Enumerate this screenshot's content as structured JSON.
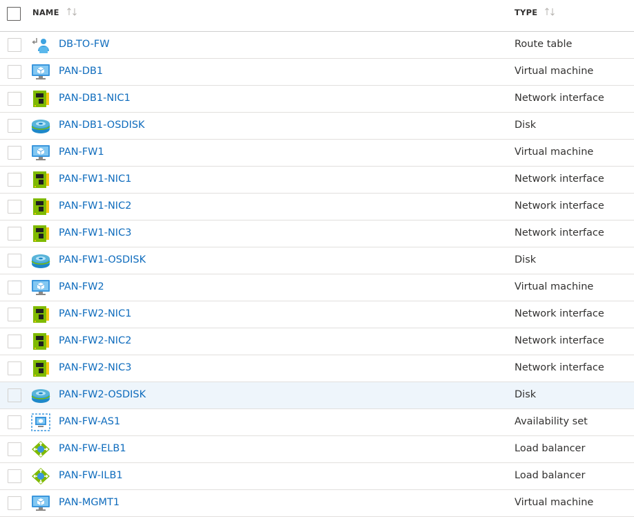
{
  "header": {
    "name_label": "NAME",
    "type_label": "TYPE"
  },
  "colors": {
    "link": "#0f6cbd",
    "selected_row": "#eef5fb",
    "border": "#e1dfdd"
  },
  "rows": [
    {
      "name": "DB-TO-FW",
      "type": "Route table",
      "icon": "route-table-icon"
    },
    {
      "name": "PAN-DB1",
      "type": "Virtual machine",
      "icon": "virtual-machine-icon"
    },
    {
      "name": "PAN-DB1-NIC1",
      "type": "Network interface",
      "icon": "network-interface-icon"
    },
    {
      "name": "PAN-DB1-OSDISK",
      "type": "Disk",
      "icon": "disk-icon"
    },
    {
      "name": "PAN-FW1",
      "type": "Virtual machine",
      "icon": "virtual-machine-icon"
    },
    {
      "name": "PAN-FW1-NIC1",
      "type": "Network interface",
      "icon": "network-interface-icon"
    },
    {
      "name": "PAN-FW1-NIC2",
      "type": "Network interface",
      "icon": "network-interface-icon"
    },
    {
      "name": "PAN-FW1-NIC3",
      "type": "Network interface",
      "icon": "network-interface-icon"
    },
    {
      "name": "PAN-FW1-OSDISK",
      "type": "Disk",
      "icon": "disk-icon"
    },
    {
      "name": "PAN-FW2",
      "type": "Virtual machine",
      "icon": "virtual-machine-icon"
    },
    {
      "name": "PAN-FW2-NIC1",
      "type": "Network interface",
      "icon": "network-interface-icon"
    },
    {
      "name": "PAN-FW2-NIC2",
      "type": "Network interface",
      "icon": "network-interface-icon"
    },
    {
      "name": "PAN-FW2-NIC3",
      "type": "Network interface",
      "icon": "network-interface-icon"
    },
    {
      "name": "PAN-FW2-OSDISK",
      "type": "Disk",
      "icon": "disk-icon",
      "highlighted": true
    },
    {
      "name": "PAN-FW-AS1",
      "type": "Availability set",
      "icon": "availability-set-icon"
    },
    {
      "name": "PAN-FW-ELB1",
      "type": "Load balancer",
      "icon": "load-balancer-icon"
    },
    {
      "name": "PAN-FW-ILB1",
      "type": "Load balancer",
      "icon": "load-balancer-icon"
    },
    {
      "name": "PAN-MGMT1",
      "type": "Virtual machine",
      "icon": "virtual-machine-icon"
    }
  ]
}
